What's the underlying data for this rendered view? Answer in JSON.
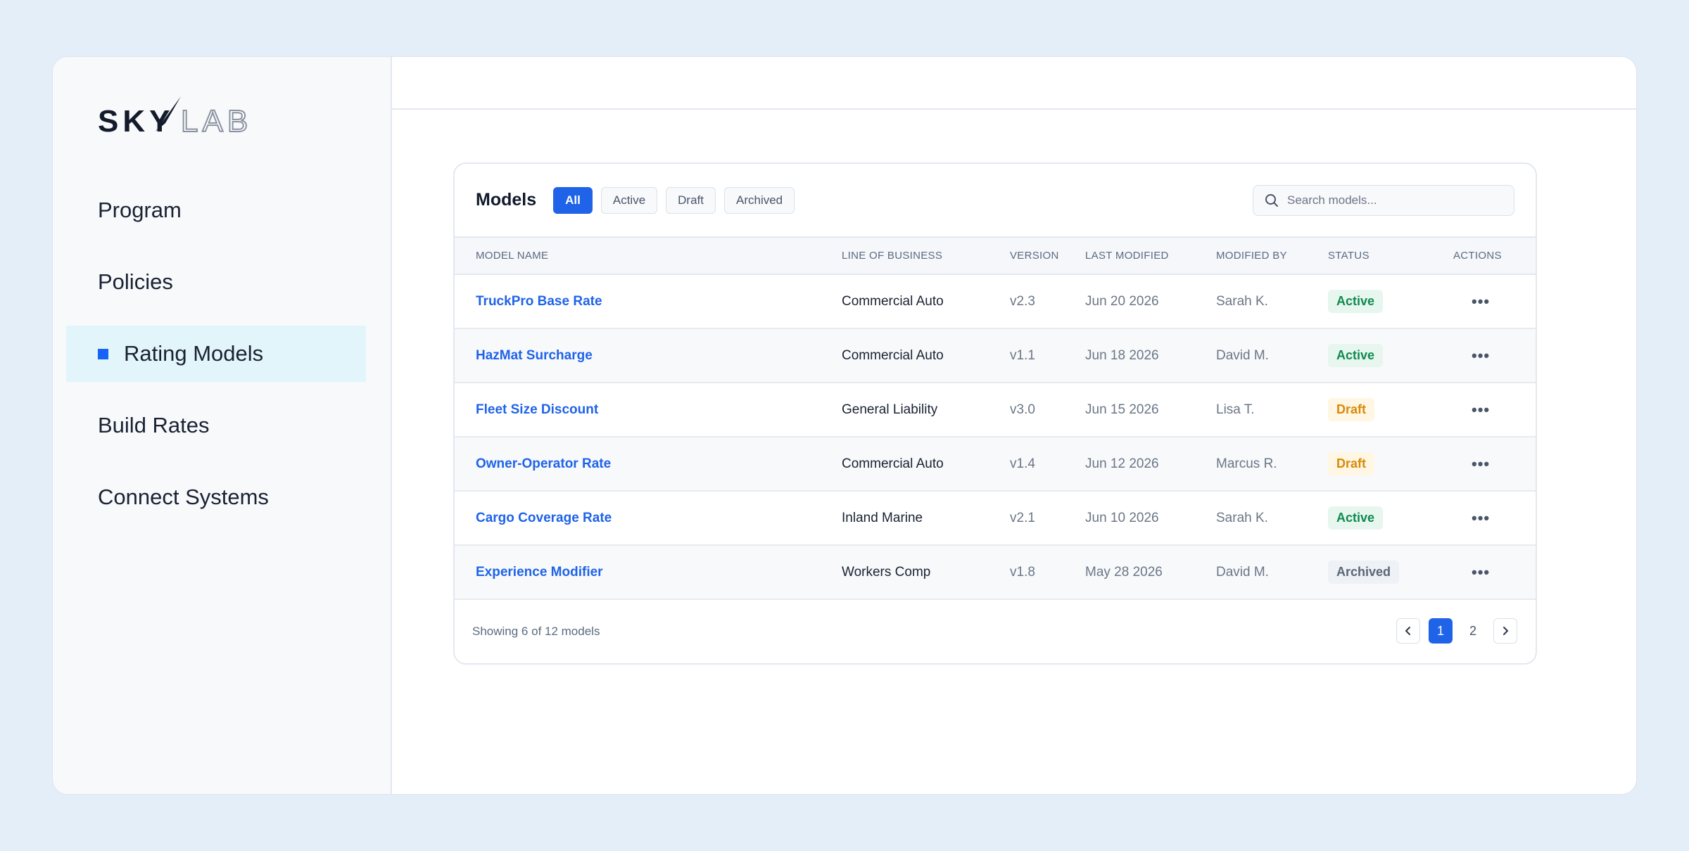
{
  "brand": {
    "logo_text": "SKYLAB",
    "accent": "#1663f5"
  },
  "sidebar": {
    "items": [
      {
        "label": "Program",
        "active": false
      },
      {
        "label": "Policies",
        "active": false
      },
      {
        "label": "Rating Models",
        "active": true
      },
      {
        "label": "Build Rates",
        "active": false
      },
      {
        "label": "Connect Systems",
        "active": false
      }
    ]
  },
  "models_card": {
    "title": "Models",
    "filters": [
      "All",
      "Active",
      "Draft",
      "Archived"
    ],
    "active_filter": "All",
    "search": {
      "placeholder": "Search models...",
      "value": ""
    },
    "columns": [
      "MODEL NAME",
      "LINE OF BUSINESS",
      "VERSION",
      "LAST MODIFIED",
      "MODIFIED BY",
      "STATUS",
      "ACTIONS"
    ],
    "rows": [
      {
        "name": "TruckPro Base Rate",
        "lob": "Commercial Auto",
        "version": "v2.3",
        "modified": "Jun 20 2026",
        "by": "Sarah K.",
        "status": "Active",
        "actions": "•••"
      },
      {
        "name": "HazMat Surcharge",
        "lob": "Commercial Auto",
        "version": "v1.1",
        "modified": "Jun 18 2026",
        "by": "David M.",
        "status": "Active",
        "actions": "•••"
      },
      {
        "name": "Fleet Size Discount",
        "lob": "General Liability",
        "version": "v3.0",
        "modified": "Jun 15 2026",
        "by": "Lisa T.",
        "status": "Draft",
        "actions": "•••"
      },
      {
        "name": "Owner-Operator Rate",
        "lob": "Commercial Auto",
        "version": "v1.4",
        "modified": "Jun 12 2026",
        "by": "Marcus R.",
        "status": "Draft",
        "actions": "•••"
      },
      {
        "name": "Cargo Coverage Rate",
        "lob": "Inland Marine",
        "version": "v2.1",
        "modified": "Jun 10 2026",
        "by": "Sarah K.",
        "status": "Active",
        "actions": "•••"
      },
      {
        "name": "Experience Modifier",
        "lob": "Workers Comp",
        "version": "v1.8",
        "modified": "May 28 2026",
        "by": "David M.",
        "status": "Archived",
        "actions": "•••"
      }
    ],
    "footer": {
      "showing": "Showing 6 of 12 models",
      "pages": [
        "1",
        "2"
      ],
      "current_page": "1"
    }
  },
  "colors": {
    "link": "#1f63e8",
    "active_badge": "#0f8a4f",
    "draft_badge": "#d98908",
    "archived_badge": "#5b6678"
  }
}
